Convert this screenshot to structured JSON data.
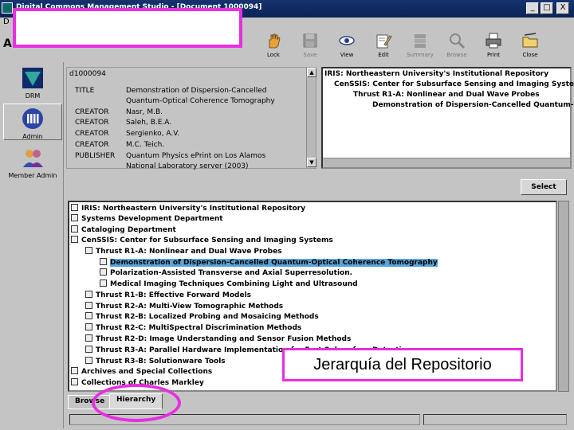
{
  "window": {
    "title": "Digital Commons Management Studio - [Document 1000094]",
    "minimize": "_",
    "maximize": "□",
    "close": "X"
  },
  "menubar": {
    "first_item": "D"
  },
  "address_label": "A",
  "toolbar": {
    "buttons": [
      {
        "label": "Lock",
        "icon": "hand-icon"
      },
      {
        "label": "Save",
        "icon": "floppy-icon",
        "disabled": true
      },
      {
        "label": "View",
        "icon": "eye-icon"
      },
      {
        "label": "Edit",
        "icon": "edit-icon"
      },
      {
        "label": "Summary",
        "icon": "summary-icon",
        "disabled": true
      },
      {
        "label": "Browse",
        "icon": "magnifier-icon",
        "disabled": true
      },
      {
        "label": "Print",
        "icon": "printer-icon"
      },
      {
        "label": "Close",
        "icon": "folder-close-icon"
      }
    ]
  },
  "sidebar": {
    "items": [
      {
        "label": "DRM",
        "icon": "drm-logo-icon"
      },
      {
        "label": "Admin",
        "icon": "admin-columns-icon"
      },
      {
        "label": "Member Admin",
        "icon": "members-icon"
      }
    ]
  },
  "metadata": {
    "id": "d1000094",
    "rows": [
      {
        "key": "TITLE",
        "value": "Demonstration of Dispersion-Cancelled"
      },
      {
        "key": "",
        "value": "Quantum-Optical Coherence Tomography"
      },
      {
        "key": "CREATOR",
        "value": "Nasr, M.B."
      },
      {
        "key": "CREATOR",
        "value": "Saleh, B.E.A."
      },
      {
        "key": "CREATOR",
        "value": "Sergienko, A.V."
      },
      {
        "key": "CREATOR",
        "value": "M.C. Teich."
      },
      {
        "key": "PUBLISHER",
        "value": "Quantum Physics ePrint on Los Alamos"
      },
      {
        "key": "",
        "value": "National Laboratory server (2003)"
      }
    ]
  },
  "location_tree": {
    "lines": [
      "IRIS: Northeastern University's Institutional Repository",
      "CenSSIS: Center for Subsurface Sensing and Imaging Syste",
      "Thrust R1-A: Nonlinear and Dual Wave Probes",
      "Demonstration of Dispersion-Cancelled Quantum-Op"
    ]
  },
  "select_button": "Select",
  "hierarchy_tree": {
    "nodes": [
      "IRIS: Northeastern University's Institutional Repository",
      "Systems Development Department",
      "Cataloging Department",
      "CenSSIS: Center for Subsurface Sensing and Imaging Systems",
      "Thrust R1-A: Nonlinear and Dual Wave Probes",
      "Demonstration of Dispersion-Cancelled Quantum-Optical Coherence Tomography",
      "Polarization-Assisted Transverse and Axial Superresolution.",
      "Medical Imaging Techniques Combining Light and Ultrasound",
      "Thrust R1-B: Effective Forward Models",
      "Thrust R2-A: Multi-View Tomographic Methods",
      "Thrust R2-B: Localized Probing and Mosaicing Methods",
      "Thrust R2-C: MultiSpectral Discrimination Methods",
      "Thrust R2-D: Image Understanding and Sensor Fusion Methods",
      "Thrust R3-A: Parallel Hardware Implementation for Fast Subsurface Detection",
      "Thrust R3-B: Solutionware Tools",
      "Archives and Special Collections",
      "Collections of Charles Markley"
    ]
  },
  "tabs": [
    "Browse",
    "Hierarchy"
  ],
  "annotation_caption": "Jerarquía del Repositorio",
  "colors": {
    "annotation": "#e62fe0",
    "selection": "#58a4d8",
    "title_bar": "#0b2357"
  }
}
